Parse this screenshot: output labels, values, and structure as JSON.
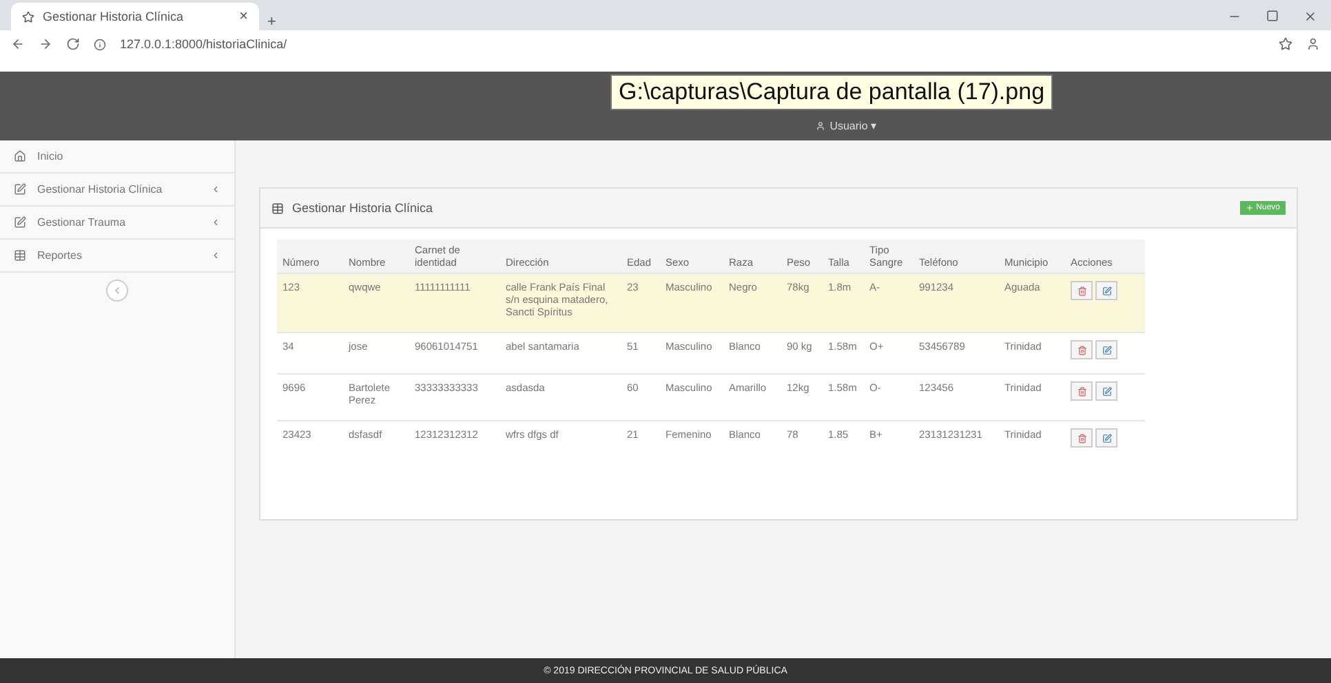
{
  "browser": {
    "tab_title": "Gestionar Historia Clínica",
    "tab_close": "×",
    "new_tab": "+",
    "url": "127.0.0.1:8000/historiaClinica/"
  },
  "tooltip": "G:\\capturas\\Captura de pantalla (17).png",
  "header": {
    "user": "Usuario ▾"
  },
  "sidebar": {
    "items": [
      {
        "label": "Inicio",
        "submenu": false
      },
      {
        "label": "Gestionar Historia Clínica",
        "submenu": true
      },
      {
        "label": "Gestionar Trauma",
        "submenu": true
      },
      {
        "label": "Reportes",
        "submenu": true
      }
    ]
  },
  "panel": {
    "title": "Gestionar Historia Clínica",
    "new_button": "Nuevo",
    "table": {
      "columns": [
        "Número",
        "Nombre",
        "Carnet de identidad",
        "Dirección",
        "Edad",
        "Sexo",
        "Raza",
        "Peso",
        "Talla",
        "Tipo Sangre",
        "Teléfono",
        "Municipio",
        "Acciones"
      ],
      "rows": [
        {
          "selected": true,
          "cells": [
            "123",
            "qwqwe",
            "11111111111",
            "calle Frank País Final s/n esquina matadero, Sancti Spíritus",
            "23",
            "Masculino",
            "Negro",
            "78kg",
            "1.8m",
            "A-",
            "991234",
            "Aguada"
          ]
        },
        {
          "selected": false,
          "cells": [
            "34",
            "jose",
            "96061014751",
            "abel santamaria",
            "51",
            "Masculino",
            "Blanco",
            "90 kg",
            "1.58m",
            "O+",
            "53456789",
            "Trinidad"
          ]
        },
        {
          "selected": false,
          "cells": [
            "9696",
            "Bartolete Perez",
            "33333333333",
            "asdasda",
            "60",
            "Masculino",
            "Amarillo",
            "12kg",
            "1.58m",
            "O-",
            "123456",
            "Trinidad"
          ]
        },
        {
          "selected": false,
          "cells": [
            "23423",
            "dsfasdf",
            "12312312312",
            "wfrs dfgs df",
            "21",
            "Femenino",
            "Blanco",
            "78",
            "1.85",
            "B+",
            "23131231231",
            "Trinidad"
          ]
        }
      ]
    }
  },
  "footer": "© 2019 DIRECCIÓN PROVINCIAL DE SALUD PÚBLICA"
}
